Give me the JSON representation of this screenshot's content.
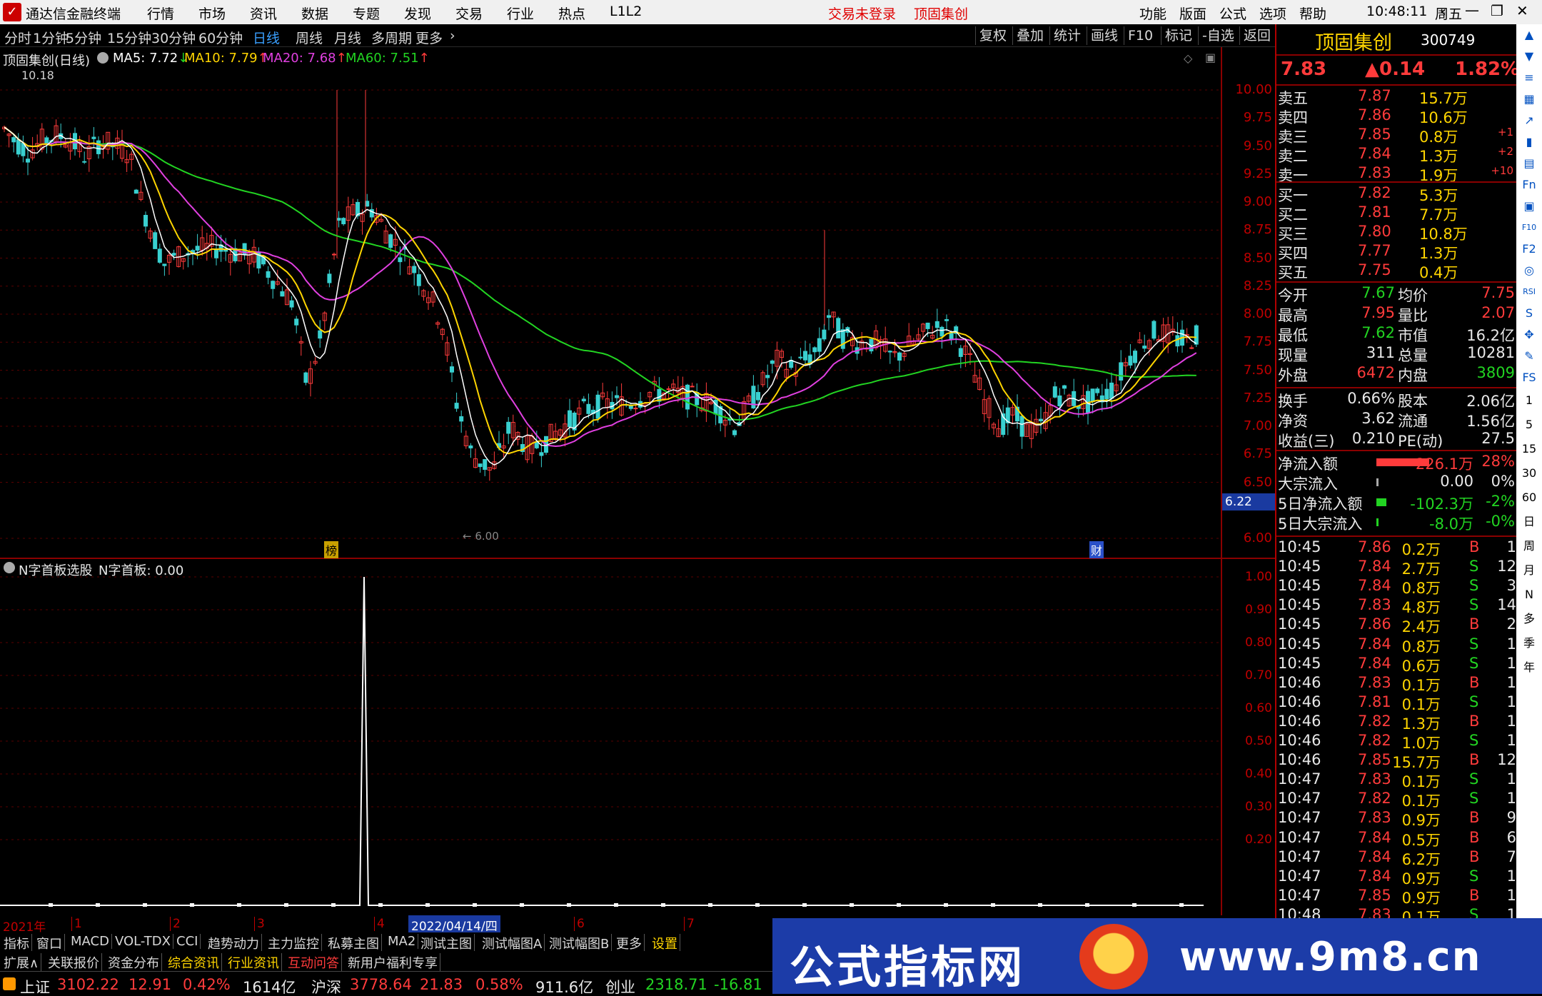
{
  "app": {
    "title": "通达信金融终端",
    "menu": [
      "行情",
      "市场",
      "资讯",
      "数据",
      "专题",
      "发现",
      "交易",
      "行业",
      "热点",
      "L1L2"
    ],
    "login": "交易未登录",
    "stock_name_menu": "顶固集创",
    "menu_right": [
      "功能",
      "版面",
      "公式",
      "选项",
      "帮助"
    ],
    "time": "10:48:11",
    "weekday": "周五"
  },
  "periods": [
    "分时",
    "1分钟",
    "5分钟",
    "15分钟",
    "30分钟",
    "60分钟",
    "日线",
    "周线",
    "月线",
    "多周期",
    "更多"
  ],
  "active_period": "日线",
  "tools": [
    "复权",
    "叠加",
    "统计",
    "画线",
    "F10",
    "标记",
    "-自选",
    "返回"
  ],
  "main_chart": {
    "title": "顶固集创(日线)",
    "ma": [
      {
        "label": "MA5: 7.72",
        "arrow": "↓",
        "color": "#ffffff"
      },
      {
        "label": "MA10: 7.79",
        "arrow": "↑",
        "color": "#ffd500"
      },
      {
        "label": "MA20: 7.68",
        "arrow": "↑",
        "color": "#e040e0"
      },
      {
        "label": "MA60: 7.51",
        "arrow": "↑",
        "color": "#22d422"
      }
    ],
    "high_mark": "10.18",
    "low_mark": "6.00",
    "axis": [
      "10.00",
      "9.75",
      "9.50",
      "9.25",
      "9.00",
      "8.75",
      "8.50",
      "8.25",
      "8.00",
      "7.75",
      "7.50",
      "7.25",
      "7.00",
      "6.75",
      "6.50",
      "6.22",
      "6.00"
    ],
    "tag1": "榜",
    "tag2": "财"
  },
  "sub_chart": {
    "title": "N字首板选股",
    "value": "N字首板: 0.00",
    "axis": [
      "1.00",
      "0.90",
      "0.80",
      "0.70",
      "0.60",
      "0.50",
      "0.40",
      "0.30",
      "0.20"
    ]
  },
  "date_axis": {
    "year": "2021年",
    "months": [
      "1",
      "2",
      "3",
      "4",
      "6",
      "7"
    ],
    "cursor_date": "2022/04/14/四"
  },
  "indicator_tabs": [
    "指标",
    "窗口",
    "MACD",
    "VOL-TDX",
    "CCI",
    "趋势动力",
    "主力监控",
    "私募主图",
    "MA2",
    "测试主图",
    "测试幅图A",
    "测试幅图B",
    "更多",
    "设置"
  ],
  "ext_tabs": [
    "扩展∧",
    "关联报价",
    "资金分布",
    "综合资讯",
    "行业资讯",
    "互动问答",
    "新用户福利专享"
  ],
  "quote": {
    "name": "顶固集创",
    "code": "300749",
    "price": "7.83",
    "change": "▲0.14",
    "pct": "1.82%",
    "asks": [
      {
        "label": "卖五",
        "price": "7.87",
        "vol": "15.7万",
        "delta": ""
      },
      {
        "label": "卖四",
        "price": "7.86",
        "vol": "10.6万",
        "delta": ""
      },
      {
        "label": "卖三",
        "price": "7.85",
        "vol": "0.8万",
        "delta": "+1"
      },
      {
        "label": "卖二",
        "price": "7.84",
        "vol": "1.3万",
        "delta": "+2"
      },
      {
        "label": "卖一",
        "price": "7.83",
        "vol": "1.9万",
        "delta": "+10"
      }
    ],
    "bids": [
      {
        "label": "买一",
        "price": "7.82",
        "vol": "5.3万"
      },
      {
        "label": "买二",
        "price": "7.81",
        "vol": "7.7万"
      },
      {
        "label": "买三",
        "price": "7.80",
        "vol": "10.8万"
      },
      {
        "label": "买四",
        "price": "7.77",
        "vol": "1.3万"
      },
      {
        "label": "买五",
        "price": "7.75",
        "vol": "0.4万"
      }
    ],
    "stats": [
      [
        "今开",
        "7.67",
        "均价",
        "7.75"
      ],
      [
        "最高",
        "7.95",
        "量比",
        "2.07"
      ],
      [
        "最低",
        "7.62",
        "市值",
        "16.2亿"
      ],
      [
        "现量",
        "311",
        "总量",
        "10281"
      ],
      [
        "外盘",
        "6472",
        "内盘",
        "3809"
      ]
    ],
    "fund": [
      [
        "换手",
        "0.66%",
        "股本",
        "2.06亿"
      ],
      [
        "净资",
        "3.62",
        "流通",
        "1.56亿"
      ],
      [
        "收益(三)",
        "0.210",
        "PE(动)",
        "27.5"
      ]
    ],
    "flow": [
      {
        "label": "净流入额",
        "value": "226.1万",
        "pct": "28%"
      },
      {
        "label": "大宗流入",
        "value": "0.00",
        "pct": "0%"
      },
      {
        "label": "5日净流入额",
        "value": "-102.3万",
        "pct": "-2%"
      },
      {
        "label": "5日大宗流入",
        "value": "-8.0万",
        "pct": "-0%"
      }
    ],
    "ticks": [
      [
        "10:45",
        "7.86",
        "0.2万",
        "B",
        "1"
      ],
      [
        "10:45",
        "7.84",
        "2.7万",
        "S",
        "12"
      ],
      [
        "10:45",
        "7.84",
        "0.8万",
        "S",
        "3"
      ],
      [
        "10:45",
        "7.83",
        "4.8万",
        "S",
        "14"
      ],
      [
        "10:45",
        "7.86",
        "2.4万",
        "B",
        "2"
      ],
      [
        "10:45",
        "7.84",
        "0.8万",
        "S",
        "1"
      ],
      [
        "10:45",
        "7.84",
        "0.6万",
        "S",
        "1"
      ],
      [
        "10:46",
        "7.83",
        "0.1万",
        "B",
        "1"
      ],
      [
        "10:46",
        "7.81",
        "0.1万",
        "S",
        "1"
      ],
      [
        "10:46",
        "7.82",
        "1.3万",
        "B",
        "1"
      ],
      [
        "10:46",
        "7.82",
        "1.0万",
        "S",
        "1"
      ],
      [
        "10:46",
        "7.85",
        "15.7万",
        "B",
        "12"
      ],
      [
        "10:47",
        "7.83",
        "0.1万",
        "S",
        "1"
      ],
      [
        "10:47",
        "7.82",
        "0.1万",
        "S",
        "1"
      ],
      [
        "10:47",
        "7.83",
        "0.9万",
        "B",
        "9"
      ],
      [
        "10:47",
        "7.84",
        "0.5万",
        "B",
        "6"
      ],
      [
        "10:47",
        "7.84",
        "6.2万",
        "B",
        "7"
      ],
      [
        "10:47",
        "7.84",
        "0.9万",
        "S",
        "1"
      ],
      [
        "10:47",
        "7.85",
        "0.9万",
        "B",
        "1"
      ],
      [
        "10:48",
        "7.83",
        "0.1万",
        "S",
        "1"
      ]
    ]
  },
  "side_icons": [
    "arrow-up-icon",
    "arrow-down-icon",
    "list-icon",
    "grid-icon",
    "chart-icon",
    "candle-icon",
    "doc-icon",
    "fund-icon",
    "news-icon",
    "f10-icon",
    "f2-icon",
    "target-icon",
    "rsi-icon",
    "s-icon",
    "move-icon",
    "pencil-icon",
    "fs-icon"
  ],
  "side_periods": [
    "1",
    "5",
    "15",
    "30",
    "60",
    "日",
    "周",
    "月",
    "N",
    "多",
    "季",
    "年"
  ],
  "statusbar": {
    "sh_label": "上证",
    "sh_index": "3102.22",
    "sh_change": "12.91",
    "sh_pct": "0.42%",
    "sh_amount": "1614亿",
    "hs_label": "沪深",
    "hs_index": "3778.64",
    "hs_change": "21.83",
    "hs_pct": "0.58%",
    "hs_amount": "911.6亿",
    "cy_label": "创业",
    "cy_index": "2318.71",
    "cy_change": "-16.81"
  },
  "banner": {
    "title": "公式指标网",
    "url": "www.9m8.cn"
  }
}
